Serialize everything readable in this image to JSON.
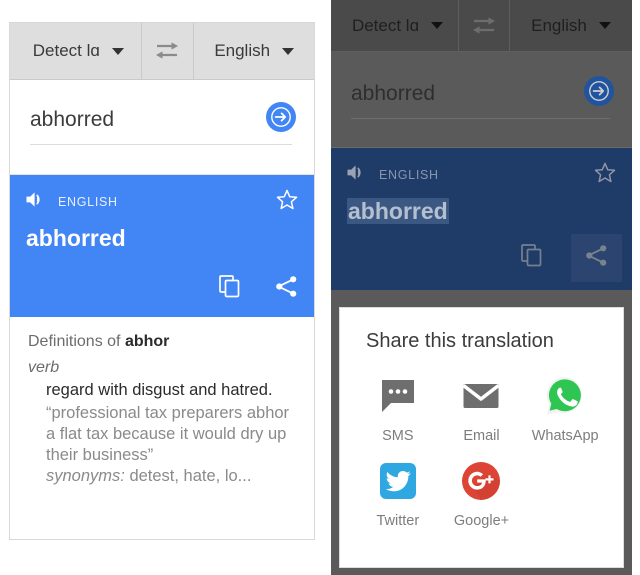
{
  "left": {
    "toolbar": {
      "source_language": "Detect lɑ",
      "target_language": "English",
      "swap_icon": "swap-horizontal-icon",
      "source_caret_icon": "chevron-down-icon",
      "target_caret_icon": "chevron-down-icon"
    },
    "input": {
      "value": "abhorred",
      "placeholder": "Enter text",
      "submit_icon": "arrow-right-circle-icon"
    },
    "result": {
      "language_label": "ENGLISH",
      "speaker_icon": "volume-up-icon",
      "star_icon": "star-outline-icon",
      "word": "abhorred",
      "copy_icon": "copy-icon",
      "share_icon": "share-icon",
      "background_color": "#4285f4"
    },
    "definitions": {
      "heading_prefix": "Definitions of ",
      "heading_term": "abhor",
      "part_of_speech": "verb",
      "sense": "regard with disgust and hatred.",
      "example": "“professional tax preparers abhor a flat tax because it would dry up their business”",
      "synonyms_label": "synonyms:",
      "synonyms_value": " detest, hate, lo..."
    }
  },
  "right": {
    "toolbar": {
      "source_language": "Detect lɑ",
      "target_language": "English",
      "swap_icon": "swap-horizontal-icon",
      "source_caret_icon": "chevron-down-icon",
      "target_caret_icon": "chevron-down-icon"
    },
    "input": {
      "value": "abhorred",
      "submit_icon": "arrow-right-circle-icon"
    },
    "result": {
      "language_label": "ENGLISH",
      "speaker_icon": "volume-up-icon",
      "star_icon": "star-outline-icon",
      "word": "abhorred",
      "copy_icon": "copy-icon",
      "share_icon": "share-icon",
      "background_color": "#1f3b68"
    },
    "share_sheet": {
      "title": "Share this translation",
      "items": [
        {
          "label": "SMS",
          "icon": "sms-chat-bubble-icon",
          "color": "#757575"
        },
        {
          "label": "Email",
          "icon": "email-envelope-icon",
          "color": "#757575"
        },
        {
          "label": "WhatsApp",
          "icon": "whatsapp-icon",
          "color": "#25d366"
        },
        {
          "label": "Twitter",
          "icon": "twitter-bird-icon",
          "color": "#2fa8e1"
        },
        {
          "label": "Google+",
          "icon": "google-plus-icon",
          "color": "#dc4436"
        }
      ]
    }
  }
}
